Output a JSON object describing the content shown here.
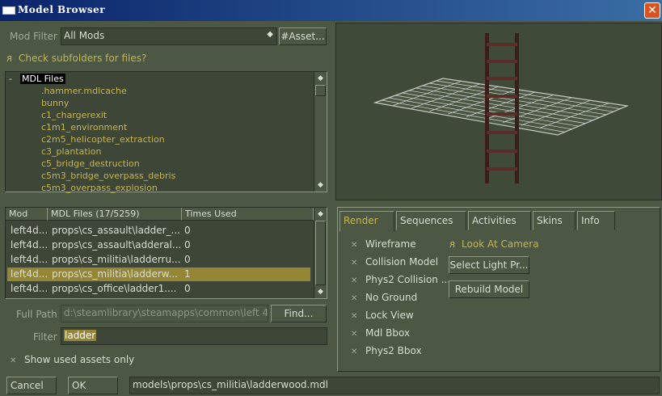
{
  "window": {
    "title": "Model Browser",
    "close": "✕"
  },
  "mod_filter": {
    "label": "Mod Filter",
    "value": "All Mods",
    "asset_button": "#Asset..."
  },
  "subfolders": {
    "mark": "ᴙ",
    "label": "Check subfolders for files?"
  },
  "tree": {
    "root_toggle": "-",
    "root_label": "MDL Files",
    "items": [
      ".hammer.mdlcache",
      "bunny",
      "c1_chargerexit",
      "c1m1_environment",
      "c2m5_helicopter_extraction",
      "c3_plantation",
      "c5_bridge_destruction",
      "c5m3_bridge_overpass_debris",
      "c5m3_overpass_explosion"
    ]
  },
  "list": {
    "headers": [
      "Mod",
      "MDL Files (17/5259)",
      "Times Used"
    ],
    "rows": [
      {
        "mod": "left4d...",
        "file": "props\\cs_assault\\ladder_...",
        "used": "0",
        "selected": false
      },
      {
        "mod": "left4d...",
        "file": "props\\cs_assault\\adderal...",
        "used": "0",
        "selected": false
      },
      {
        "mod": "left4d...",
        "file": "props\\cs_militia\\ladderru...",
        "used": "0",
        "selected": false
      },
      {
        "mod": "left4d...",
        "file": "props\\cs_militia\\ladderw...",
        "used": "1",
        "selected": true
      },
      {
        "mod": "left4d...",
        "file": "props\\cs_office\\ladder1....",
        "used": "0",
        "selected": false
      }
    ]
  },
  "full_path": {
    "label": "Full Path",
    "value": "d:\\steamlibrary\\steamapps\\common\\left 4 c",
    "find_button": "Find..."
  },
  "filter": {
    "label": "Filter",
    "value": "ladder"
  },
  "show_used": {
    "mark": "✕",
    "label": "Show used assets only"
  },
  "tabs": [
    "Render",
    "Sequences",
    "Activities",
    "Skins",
    "Info"
  ],
  "render": {
    "options": [
      {
        "mark": "✕",
        "label": "Wireframe"
      },
      {
        "mark": "✕",
        "label": "Collision Model"
      },
      {
        "mark": "✕",
        "label": "Phys2 Collision ..."
      },
      {
        "mark": "✕",
        "label": "No Ground"
      },
      {
        "mark": "✕",
        "label": "Lock View"
      },
      {
        "mark": "✕",
        "label": "Mdl Bbox"
      },
      {
        "mark": "✕",
        "label": "Phys2 Bbox"
      }
    ],
    "look_at_camera": {
      "mark": "ᴙ",
      "label": "Look At Camera"
    },
    "select_light": "Select Light Pr...",
    "rebuild_model": "Rebuild Model"
  },
  "bottom": {
    "cancel": "Cancel",
    "ok": "OK",
    "path": "models\\props\\cs_militia\\ladderwood.mdl"
  },
  "icons": {
    "scroll_up": "▲",
    "scroll_down": "▼",
    "diamond": "◆"
  },
  "colors": {
    "accent": "#c4b550",
    "selection": "#958635",
    "title_start": "#0a246a",
    "title_end": "#3a6ea5"
  }
}
